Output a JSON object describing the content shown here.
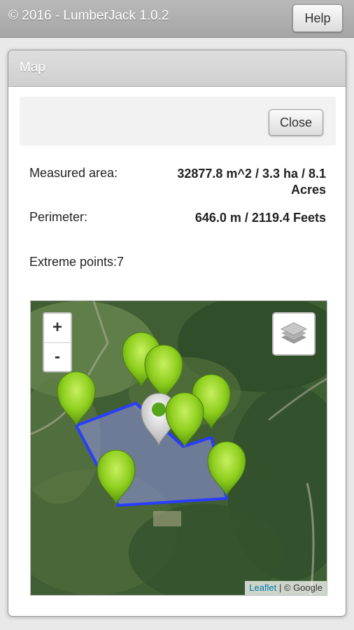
{
  "app": {
    "title": "© 2016 - LumberJack 1.0.2",
    "help_label": "Help"
  },
  "dialog": {
    "title": "Map",
    "close_label": "Close",
    "measured_area_label": "Measured area:",
    "measured_area_value": "32877.8 m^2 / 3.3 ha / 8.1 Acres",
    "perimeter_label": "Perimeter:",
    "perimeter_value": "646.0 m / 2119.4 Feets",
    "extreme_points_label": "Extreme points:7"
  },
  "map": {
    "zoom_in_label": "+",
    "zoom_out_label": "-",
    "attribution_link": "Leaflet",
    "attribution_rest": " | © Google",
    "polygon_color": "#2a3dff",
    "marker_color": "#8fcf1e"
  }
}
